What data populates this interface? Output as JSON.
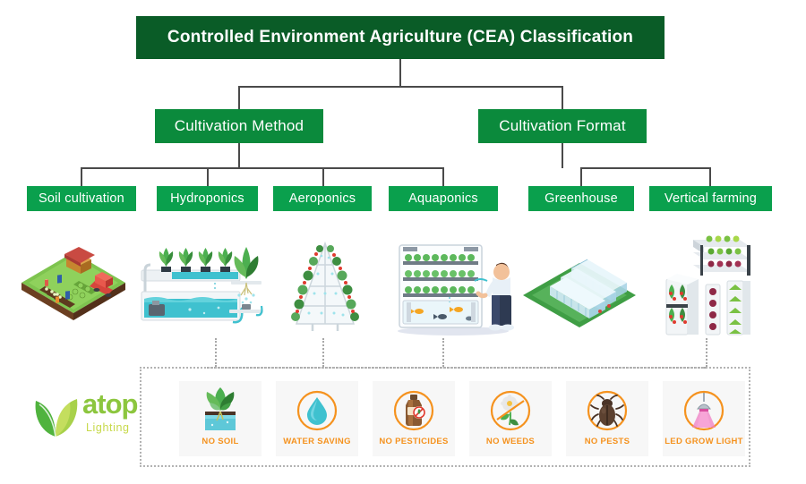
{
  "diagram": {
    "root": {
      "label": "Controlled Environment Agriculture (CEA) Classification"
    },
    "branches": [
      {
        "label": "Cultivation Method"
      },
      {
        "label": "Cultivation Format"
      }
    ],
    "leaves": [
      {
        "label": "Soil cultivation",
        "illustration": "soil-farm-isometric-illustration"
      },
      {
        "label": "Hydroponics",
        "illustration": "hydroponics-system-illustration"
      },
      {
        "label": "Aeroponics",
        "illustration": "aeroponics-a-frame-illustration"
      },
      {
        "label": "Aquaponics",
        "illustration": "aquaponics-rack-with-person-illustration"
      },
      {
        "label": "Greenhouse",
        "illustration": "greenhouse-isometric-illustration"
      },
      {
        "label": "Vertical farming",
        "illustration": "vertical-farming-towers-illustration"
      }
    ]
  },
  "benefits": {
    "items": [
      {
        "label": "NO SOIL",
        "icon": "plant-in-water-icon"
      },
      {
        "label": "WATER SAVING",
        "icon": "water-drop-icon"
      },
      {
        "label": "NO PESTICIDES",
        "icon": "pesticide-bottle-prohibited-icon"
      },
      {
        "label": "NO WEEDS",
        "icon": "weed-flower-prohibited-icon"
      },
      {
        "label": "NO PESTS",
        "icon": "bug-prohibited-icon"
      },
      {
        "label": "LED GROW LIGHT",
        "icon": "led-grow-lamp-icon"
      }
    ]
  },
  "logo": {
    "name": "atop",
    "tagline": "Lighting",
    "mark": "double-leaf-icon"
  },
  "colors": {
    "root_green": "#0a5c27",
    "branch_green": "#0b8a3c",
    "leaf_green": "#0aa04d",
    "line_gray": "#4a4a4a",
    "badge_orange": "#F5921E",
    "panel_border": "#b3b3b3",
    "logo_green": "#8CC63E",
    "logo_lime": "#C7D94A"
  }
}
